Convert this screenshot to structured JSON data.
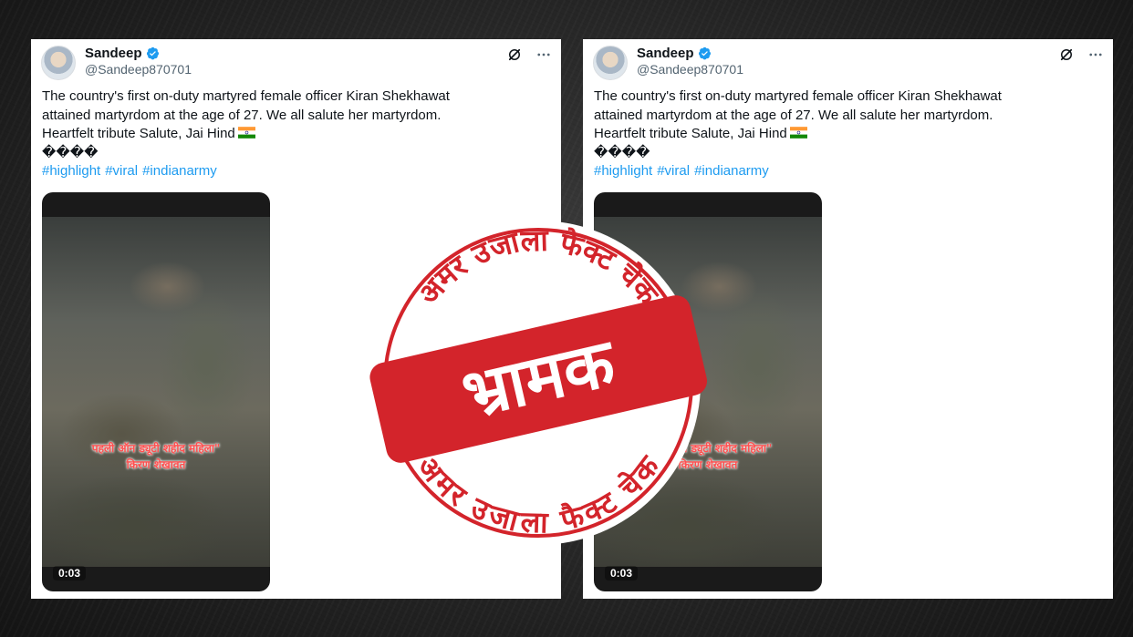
{
  "posts": [
    {
      "user_name": "Sandeep",
      "handle": "@Sandeep870701",
      "text_line1": "The country's first on-duty martyred female officer Kiran Shekhawat",
      "text_line2": "attained martyrdom at the age of 27. We all salute her martyrdom.",
      "text_line3": "Heartfelt tribute Salute, Jai Hind",
      "text_line4": "����",
      "hashtags": [
        "#highlight",
        "#viral",
        "#indianarmy"
      ],
      "video_caption_line1": "पहली ऑन ड्यूटी शहीद महिला\"",
      "video_caption_line2": "किरण शेखावत",
      "video_time": "0:03"
    },
    {
      "user_name": "Sandeep",
      "handle": "@Sandeep870701",
      "text_line1": "The country's first on-duty martyred female officer Kiran Shekhawat",
      "text_line2": "attained martyrdom at the age of 27. We all salute her martyrdom.",
      "text_line3": "Heartfelt tribute Salute, Jai Hind",
      "text_line4": "����",
      "hashtags": [
        "#highlight",
        "#viral",
        "#indianarmy"
      ],
      "video_caption_line1": "पहली ऑन ड्यूटी शहीद महिला\"",
      "video_caption_line2": "किरण शेखावत",
      "video_time": "0:03"
    }
  ],
  "stamp": {
    "verdict": "भ्रामक",
    "ring_text": "अमर उजाला फैक्ट चेक"
  },
  "colors": {
    "stamp_red": "#d3242b",
    "link_blue": "#1d9bf0",
    "verified_blue": "#1d9bf0"
  }
}
